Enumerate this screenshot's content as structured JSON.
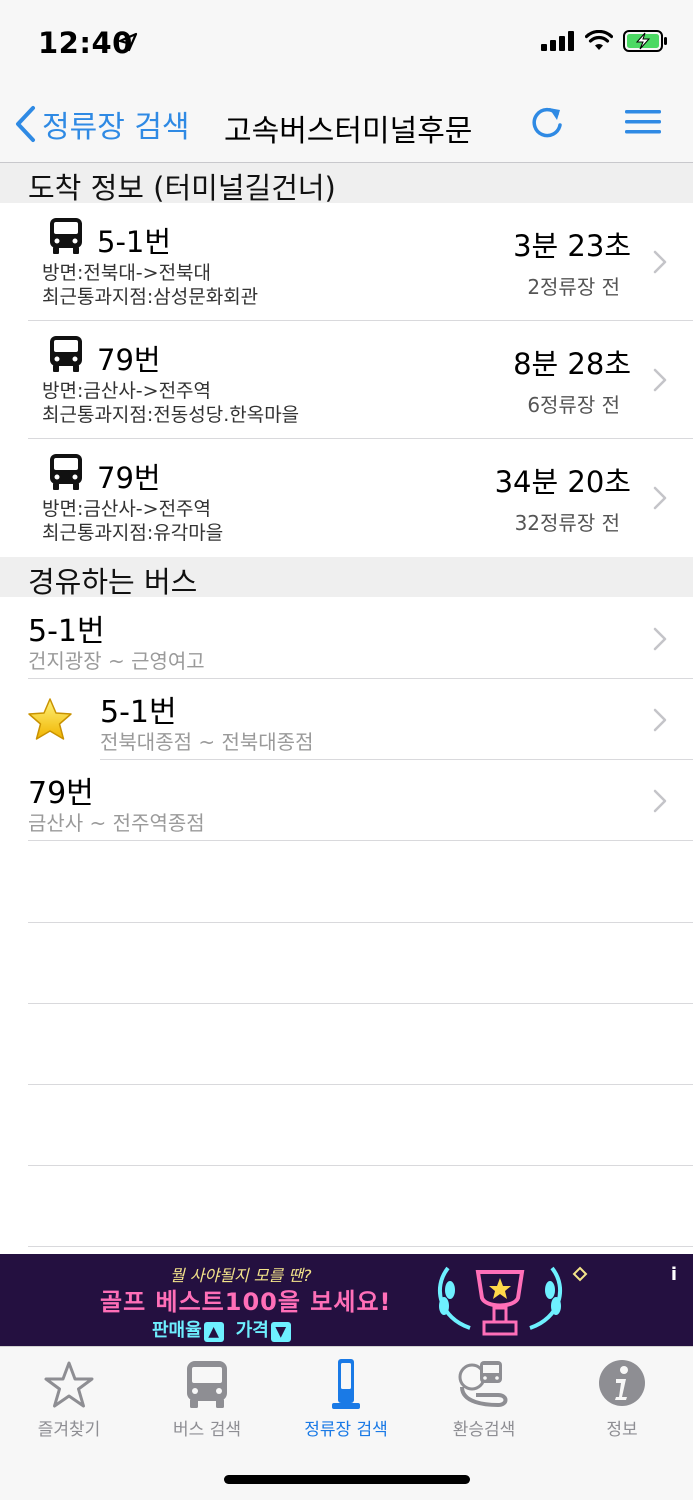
{
  "status": {
    "time": "12:40"
  },
  "nav": {
    "back_label": "정류장 검색",
    "title": "고속버스터미널후문"
  },
  "arrival_section": {
    "title": "도착 정보 (터미널길건너)",
    "items": [
      {
        "route": "5-1번",
        "direction": "방면:전북대->전북대",
        "last_stop": "최근통과지점:삼성문화회관",
        "time": "3분 23초",
        "stops": "2정류장 전"
      },
      {
        "route": "79번",
        "direction": "방면:금산사->전주역",
        "last_stop": "최근통과지점:전동성당.한옥마을",
        "time": "8분 28초",
        "stops": "6정류장 전"
      },
      {
        "route": "79번",
        "direction": "방면:금산사->전주역",
        "last_stop": "최근통과지점:유각마을",
        "time": "34분 20초",
        "stops": "32정류장 전"
      }
    ]
  },
  "routes_section": {
    "title": "경유하는 버스",
    "items": [
      {
        "name": "5-1번",
        "range": "건지광장 ~ 근영여고",
        "favorite": false
      },
      {
        "name": "5-1번",
        "range": "전북대종점 ~ 전북대종점",
        "favorite": true
      },
      {
        "name": "79번",
        "range": "금산사 ~ 전주역종점",
        "favorite": false
      }
    ]
  },
  "ad": {
    "small_text": "뭘 사야될지 모를 땐?",
    "main_text": "골프 베스트100을 보세요!",
    "sub_left": "판매율",
    "sub_right": "가격",
    "info": "i"
  },
  "tabs": [
    {
      "label": "즐겨찾기",
      "icon": "star-outline-icon",
      "active": false
    },
    {
      "label": "버스 검색",
      "icon": "bus-icon",
      "active": false
    },
    {
      "label": "정류장 검색",
      "icon": "bus-stop-icon",
      "active": true
    },
    {
      "label": "환승검색",
      "icon": "transfer-icon",
      "active": false
    },
    {
      "label": "정보",
      "icon": "info-icon",
      "active": false
    }
  ],
  "colors": {
    "accent": "#2f8ae4",
    "active_tab": "#1a7ae6",
    "section_bg": "#efefef"
  }
}
